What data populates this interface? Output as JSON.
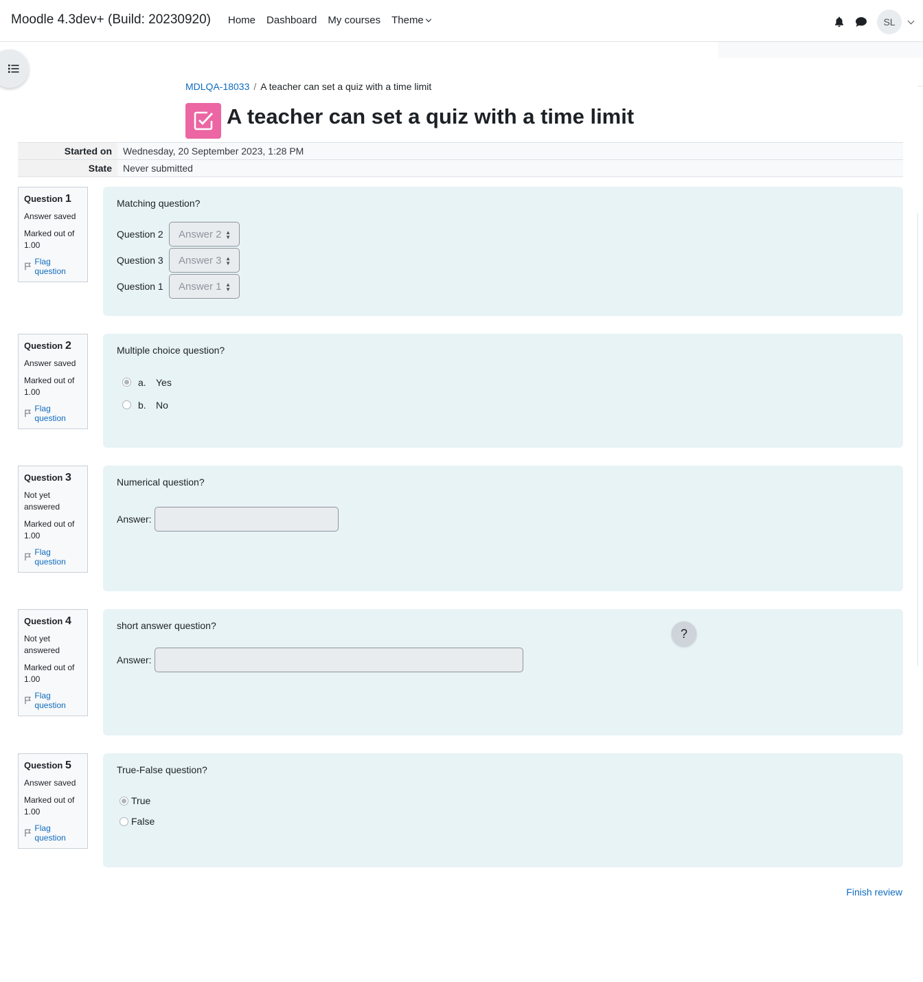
{
  "navbar": {
    "site_name": "Moodle 4.3dev+ (Build: 20230920)",
    "links": [
      "Home",
      "Dashboard",
      "My courses"
    ],
    "theme_label": "Theme",
    "avatar_initials": "SL"
  },
  "breadcrumb": {
    "course": "MDLQA-18033",
    "separator": "/",
    "current": "A teacher can set a quiz with a time limit"
  },
  "page_title": "A teacher can set a quiz with a time limit",
  "summary": {
    "started_on_label": "Started on",
    "started_on_value": "Wednesday, 20 September 2023, 1:28 PM",
    "state_label": "State",
    "state_value": "Never submitted"
  },
  "questions": [
    {
      "label": "Question",
      "number": "1",
      "state": "Answer saved",
      "grade": "Marked out of 1.00",
      "flag": "Flag question",
      "text": "Matching question?",
      "matches": [
        {
          "stem": "Question 2",
          "answer": "Answer 2"
        },
        {
          "stem": "Question 3",
          "answer": "Answer 3"
        },
        {
          "stem": "Question 1",
          "answer": "Answer 1"
        }
      ]
    },
    {
      "label": "Question",
      "number": "2",
      "state": "Answer saved",
      "grade": "Marked out of 1.00",
      "flag": "Flag question",
      "text": "Multiple choice question?",
      "choices": [
        {
          "letter": "a.",
          "text": "Yes",
          "selected": true
        },
        {
          "letter": "b.",
          "text": "No",
          "selected": false
        }
      ]
    },
    {
      "label": "Question",
      "number": "3",
      "state": "Not yet answered",
      "grade": "Marked out of 1.00",
      "flag": "Flag question",
      "text": "Numerical question?",
      "answer_label": "Answer:"
    },
    {
      "label": "Question",
      "number": "4",
      "state": "Not yet answered",
      "grade": "Marked out of 1.00",
      "flag": "Flag question",
      "text": "short answer question?",
      "answer_label": "Answer:"
    },
    {
      "label": "Question",
      "number": "5",
      "state": "Answer saved",
      "grade": "Marked out of 1.00",
      "flag": "Flag question",
      "text": "True-False question?",
      "options": [
        {
          "text": "True",
          "selected": true
        },
        {
          "text": "False",
          "selected": false
        }
      ]
    }
  ],
  "help_button": "?",
  "finish_review": "Finish review",
  "icons": {
    "notifications": "bell-icon",
    "messages": "chat-bubble-icon",
    "course_index": "list-icon",
    "quiz": "checkbox-icon",
    "flag": "flag-icon"
  },
  "colors": {
    "accent": "#0f6cbf",
    "quiz_icon_bg": "#eb66a2",
    "question_bg": "#e7f3f5"
  }
}
